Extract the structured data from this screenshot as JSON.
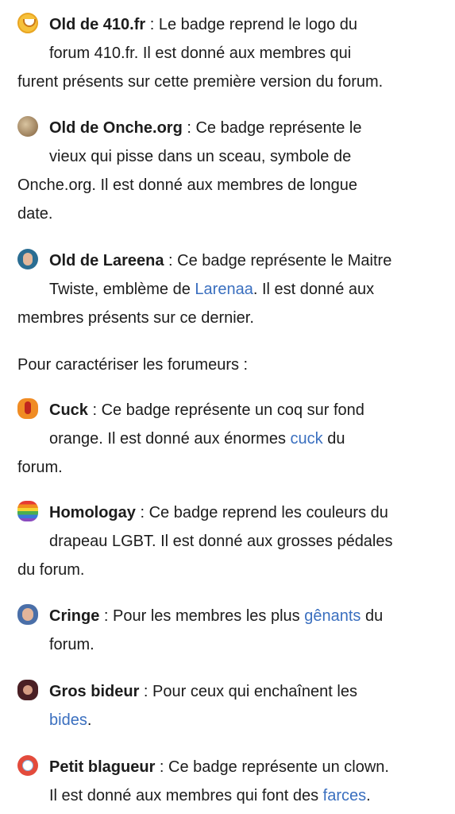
{
  "badges_part1": [
    {
      "icon": "410-logo-icon",
      "name": "Old de 410.fr",
      "sep": " : ",
      "lines": [
        "Le badge reprend le logo du",
        "forum 410.fr. Il est donné aux membres qui",
        "furent présents sur cette première version du forum."
      ]
    },
    {
      "icon": "old-man-icon",
      "name": "Old de Onche.org",
      "sep": " : ",
      "lines": [
        "Ce badge représente le",
        "vieux qui pisse dans un sceau, symbole de",
        "Onche.org. Il est donné aux membres de longue",
        "date."
      ]
    },
    {
      "icon": "maitre-twiste-icon",
      "name": "Old de Lareena",
      "sep": " : ",
      "line1": "Ce badge représente le Maitre",
      "line2_before": "Twiste, emblème de ",
      "line2_link": "Larenaa",
      "line2_after": ". Il est donné aux",
      "line3": "membres présents sur ce dernier."
    }
  ],
  "intro": "Pour caractériser les forumeurs :",
  "badges_part2": [
    {
      "icon": "rooster-icon",
      "name": "Cuck",
      "sep": " : ",
      "line1": "Ce badge représente un coq sur fond",
      "line2_before": "orange. Il est donné aux énormes ",
      "line2_link": "cuck",
      "line2_after": " du",
      "line3": "forum."
    },
    {
      "icon": "rainbow-flag-icon",
      "name": "Homologay",
      "sep": " : ",
      "line1": "Ce badge reprend les couleurs du",
      "line2": "drapeau LGBT. Il est donné aux grosses pédales",
      "line3": "du forum."
    },
    {
      "icon": "cringe-face-icon",
      "name": "Cringe",
      "sep": " : ",
      "line1_before": "Pour les membres les plus ",
      "line1_link": "gênants",
      "line1_after": " du",
      "line2": "forum."
    },
    {
      "icon": "bideur-face-icon",
      "name": "Gros bideur",
      "sep": " : ",
      "line1": "Pour ceux qui enchaînent les",
      "line2_link": "bides",
      "line2_after": "."
    },
    {
      "icon": "clown-icon",
      "name": "Petit blagueur",
      "sep": " : ",
      "line1": "Ce badge représente un clown.",
      "line2_before": "Il est donné aux membres qui font des ",
      "line2_link": "farces",
      "line2_after": "."
    }
  ]
}
